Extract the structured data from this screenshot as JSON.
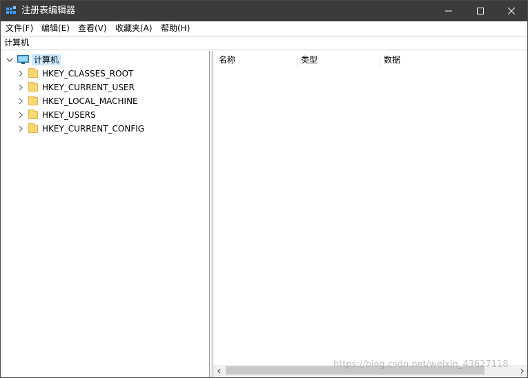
{
  "window": {
    "title": "注册表编辑器"
  },
  "menu": [
    "文件(F)",
    "编辑(E)",
    "查看(V)",
    "收藏夹(A)",
    "帮助(H)"
  ],
  "address": "计算机",
  "tree": {
    "root": "计算机",
    "keys": [
      "HKEY_CLASSES_ROOT",
      "HKEY_CURRENT_USER",
      "HKEY_LOCAL_MACHINE",
      "HKEY_USERS",
      "HKEY_CURRENT_CONFIG"
    ]
  },
  "columns": [
    "名称",
    "类型",
    "数据"
  ],
  "watermark": "https://blog.csdn.net/weixin_43627118",
  "colors": {
    "titlebar": "#3b3b3b",
    "selection": "#cce8ff",
    "folder": "#f8d775"
  }
}
